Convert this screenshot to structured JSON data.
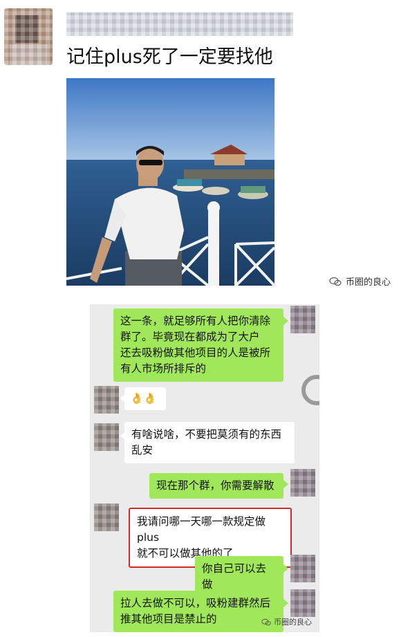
{
  "post": {
    "text": "记住plus死了一定要找他"
  },
  "watermark": {
    "top": "币圈的良心",
    "bottom": "币圈的良心"
  },
  "chat": {
    "messages": [
      {
        "side": "right",
        "lines": [
          "这一条，就足够所有人把你清除",
          "群了。毕竟现在都成为了大户",
          "还去吸粉做其他项目的人是被所",
          "有人市场所排斥的"
        ]
      },
      {
        "side": "left",
        "lines": [
          "👌👌"
        ]
      },
      {
        "side": "left",
        "lines": [
          "有啥说啥，不要把莫须有的东西",
          "乱安"
        ]
      },
      {
        "side": "right",
        "lines": [
          "现在那个群，你需要解散"
        ]
      },
      {
        "side": "left",
        "lines": [
          "我请问哪一天哪一款规定做 plus",
          "就不可以做其他的了"
        ],
        "highlighted": true
      },
      {
        "side": "right",
        "lines": [
          "你自己可以去做"
        ]
      },
      {
        "side": "right",
        "lines": [
          "拉人去做不可以，吸粉建群然后",
          "推其他项目是禁止的"
        ]
      }
    ]
  }
}
